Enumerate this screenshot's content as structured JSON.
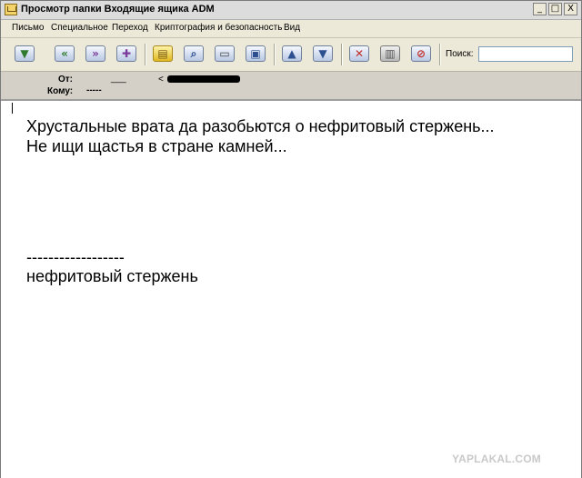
{
  "window": {
    "title": "Просмотр папки Входящие ящика ADM",
    "buttons": [
      "_",
      "□",
      "X"
    ]
  },
  "menu": [
    "Письмо",
    "Специальное",
    "Переход",
    "Криптография и безопасность",
    "Вид"
  ],
  "toolbar": {
    "icons": [
      "receive-mail-icon",
      "reply-icon",
      "forward-icon",
      "new-message-icon",
      "notes-icon",
      "find-icon",
      "print-icon",
      "save-icon",
      "previous-icon",
      "next-icon",
      "delete-icon",
      "trash-icon",
      "block-icon"
    ],
    "search_label": "Поиск:",
    "search_value": ""
  },
  "header": {
    "from_label": "От:",
    "from_value": "___",
    "from_email_start": "<",
    "to_label": "Кому:",
    "to_value": "-----"
  },
  "message": {
    "line1": "Хрустальные врата да разобьются о нефритовый стержень...",
    "line2": "Не ищи щастья в стране камней...",
    "separator": "------------------",
    "signature": "нефритовый стержень"
  },
  "watermark": "YAPLAKAL.COM"
}
